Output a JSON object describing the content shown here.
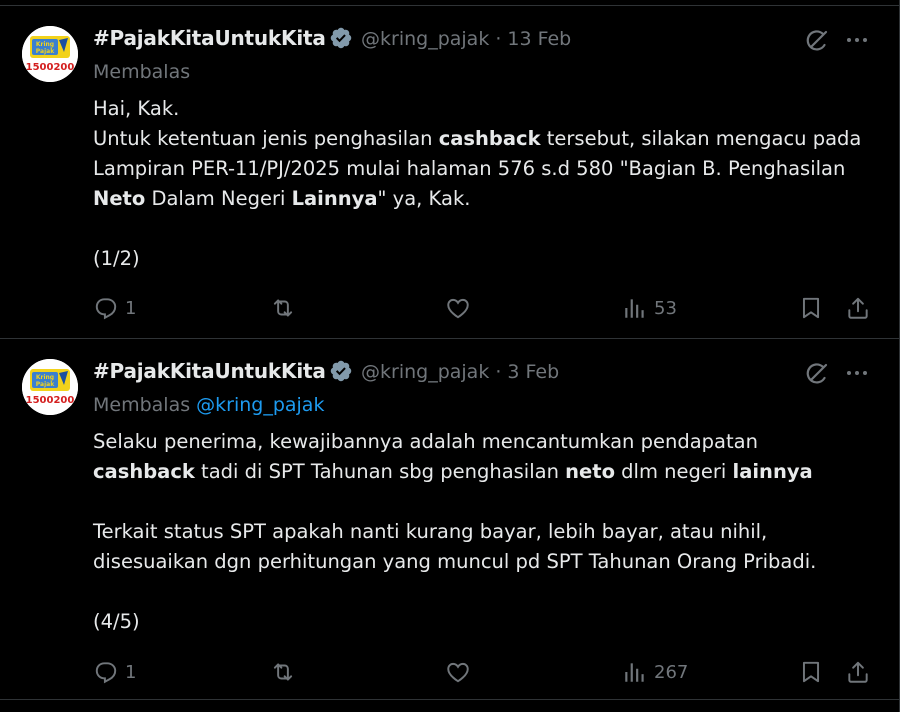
{
  "tweets": [
    {
      "author_name": "#PajakKitaUntukKita",
      "handle": "@kring_pajak",
      "date": "13 Feb",
      "replying_label": "Membalas",
      "replying_to": "",
      "avatar": {
        "top_text": "Kring Pajak",
        "number": "1500200"
      },
      "body": [
        {
          "segments": [
            {
              "text": "Hai, Kak."
            }
          ]
        },
        {
          "segments": [
            {
              "text": "Untuk ketentuan jenis penghasilan "
            },
            {
              "text": "cashback",
              "bold": true
            },
            {
              "text": " tersebut, silakan mengacu pada Lampiran PER-11/PJ/2025 mulai halaman 576 s.d 580 \"Bagian B. Penghasilan "
            },
            {
              "text": "Neto",
              "bold": true
            },
            {
              "text": " Dalam Negeri "
            },
            {
              "text": "Lainnya",
              "bold": true
            },
            {
              "text": "\" ya, Kak."
            }
          ]
        },
        {
          "segments": [
            {
              "text": ""
            }
          ]
        },
        {
          "segments": [
            {
              "text": "(1/2)"
            }
          ]
        }
      ],
      "reply_count": "1",
      "repost_count": "",
      "like_count": "",
      "view_count": "53"
    },
    {
      "author_name": "#PajakKitaUntukKita",
      "handle": "@kring_pajak",
      "date": "3 Feb",
      "replying_label": "Membalas",
      "replying_to": "@kring_pajak",
      "avatar": {
        "top_text": "Kring Pajak",
        "number": "1500200"
      },
      "body": [
        {
          "segments": [
            {
              "text": "Selaku penerima, kewajibannya adalah mencantumkan pendapatan "
            },
            {
              "text": "cashback",
              "bold": true
            },
            {
              "text": " tadi di SPT Tahunan sbg penghasilan "
            },
            {
              "text": "neto",
              "bold": true
            },
            {
              "text": " dlm negeri "
            },
            {
              "text": "lainnya",
              "bold": true
            }
          ]
        },
        {
          "segments": [
            {
              "text": ""
            }
          ]
        },
        {
          "segments": [
            {
              "text": "Terkait status SPT apakah nanti kurang bayar, lebih bayar, atau nihil, disesuaikan dgn perhitungan yang muncul pd SPT Tahunan Orang Pribadi."
            }
          ]
        },
        {
          "segments": [
            {
              "text": ""
            }
          ]
        },
        {
          "segments": [
            {
              "text": "(4/5)"
            }
          ]
        }
      ],
      "reply_count": "1",
      "repost_count": "",
      "like_count": "",
      "view_count": "267"
    }
  ],
  "icons": {
    "verified": "verified-badge-icon",
    "grok": "grok-icon",
    "more": "more-icon",
    "reply": "reply-icon",
    "repost": "repost-icon",
    "like": "like-icon",
    "views": "views-icon",
    "bookmark": "bookmark-icon",
    "share": "share-icon"
  },
  "colors": {
    "background": "#000000",
    "text": "#e7e9ea",
    "secondary": "#71767b",
    "link": "#1d9bf0",
    "divider": "#2f3336"
  }
}
